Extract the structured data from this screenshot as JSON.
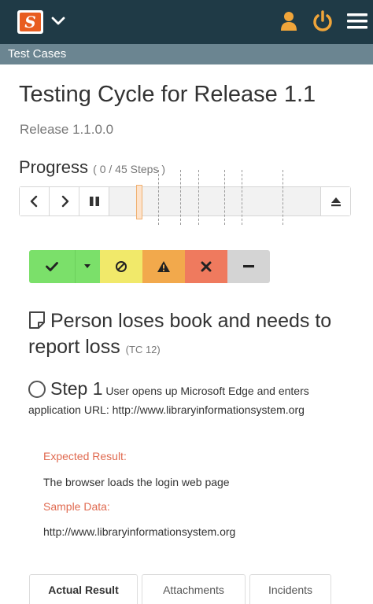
{
  "header": {
    "logo_letter": "S",
    "section": "Test Cases",
    "icons": [
      "app-logo",
      "chevron-down-icon",
      "user-icon",
      "power-icon",
      "menu-icon"
    ]
  },
  "page": {
    "title": "Testing Cycle for Release 1.1",
    "release": "Release 1.1.0.0"
  },
  "progress": {
    "label": "Progress",
    "steps_text": "( 0 / 45 Steps )",
    "completed_steps": 0,
    "total_steps": 45,
    "controls": [
      "chevron-left-icon",
      "chevron-right-icon",
      "pause-icon",
      "eject-icon"
    ]
  },
  "status_buttons": [
    {
      "name": "pass",
      "icon": "check-icon",
      "color": "#7be06a"
    },
    {
      "name": "pass-dropdown",
      "icon": "caret-down-icon",
      "color": "#7be06a"
    },
    {
      "name": "blocked",
      "icon": "blocked-icon",
      "color": "#f1e96a"
    },
    {
      "name": "caution",
      "icon": "warning-icon",
      "color": "#f2a94c"
    },
    {
      "name": "fail",
      "icon": "x-icon",
      "color": "#ef7a5e"
    },
    {
      "name": "not-applicable",
      "icon": "minus-icon",
      "color": "#d4d4d4"
    }
  ],
  "test_case": {
    "name": "Person loses book and needs to report loss",
    "code": "(TC 12)"
  },
  "step": {
    "label": "Step 1",
    "description": "User opens up Microsoft Edge and enters application URL: http://www.libraryinformationsystem.org",
    "expected_label": "Expected Result:",
    "expected_value": "The browser loads the login web page",
    "sample_label": "Sample Data:",
    "sample_value": "http://www.libraryinformationsystem.org"
  },
  "tabs": [
    {
      "label": "Actual Result",
      "active": true
    },
    {
      "label": "Attachments",
      "active": false
    },
    {
      "label": "Incidents",
      "active": false
    }
  ],
  "colors": {
    "topbar": "#1f3a46",
    "subbar": "#6b8591",
    "accent": "#e85d20",
    "label_red": "#e06a50"
  }
}
